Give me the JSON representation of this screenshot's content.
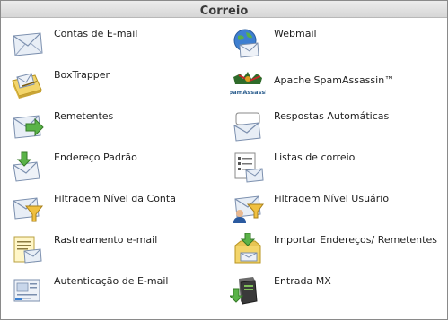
{
  "header": {
    "title": "Correio"
  },
  "items": [
    {
      "label": "Contas de E-mail",
      "icon": "envelope-icon"
    },
    {
      "label": "Webmail",
      "icon": "webmail-globe-icon"
    },
    {
      "label": "BoxTrapper",
      "icon": "boxtrapper-icon"
    },
    {
      "label": "Apache SpamAssassin™",
      "icon": "spamassassin-logo"
    },
    {
      "label": "Remetentes",
      "icon": "forwarders-icon"
    },
    {
      "label": "Respostas Automáticas",
      "icon": "autoresponder-icon"
    },
    {
      "label": "Endereço Padrão",
      "icon": "default-address-icon"
    },
    {
      "label": "Listas de correio",
      "icon": "mailing-list-icon"
    },
    {
      "label": "Filtragem Nível da Conta",
      "icon": "account-filter-icon"
    },
    {
      "label": "Filtragem Nível Usuário",
      "icon": "user-filter-icon"
    },
    {
      "label": "Rastreamento e-mail",
      "icon": "email-tracking-icon"
    },
    {
      "label": "Importar Endereços/ Remetentes",
      "icon": "import-icon"
    },
    {
      "label": "Autenticação de E-mail",
      "icon": "email-auth-icon"
    },
    {
      "label": "Entrada MX",
      "icon": "mx-entry-icon"
    }
  ],
  "logo": {
    "spamassassin_text": "SpamAssassin"
  }
}
